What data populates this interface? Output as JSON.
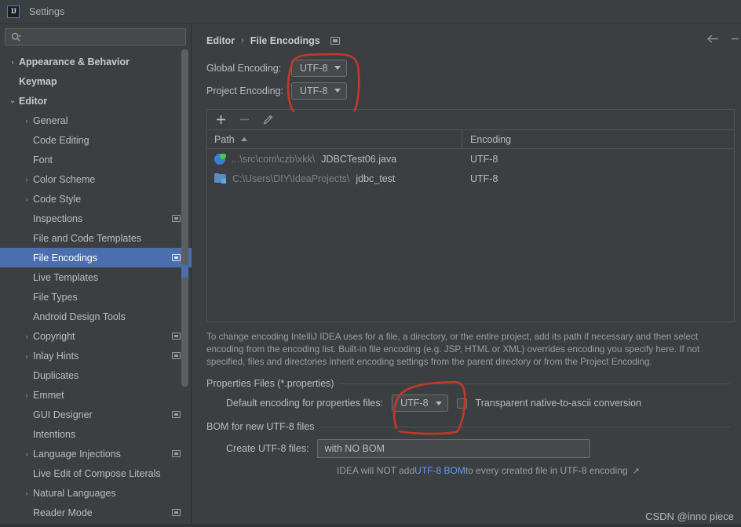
{
  "window": {
    "logo_text": "IJ",
    "title": "Settings"
  },
  "sidebar": {
    "search": {
      "value": "",
      "placeholder": ""
    },
    "items": [
      {
        "label": "Appearance & Behavior",
        "twisty": "›",
        "indent": 0,
        "bold": true,
        "badge": false,
        "selected": false
      },
      {
        "label": "Keymap",
        "twisty": "",
        "indent": 0,
        "bold": true,
        "badge": false,
        "selected": false
      },
      {
        "label": "Editor",
        "twisty": "⌄",
        "indent": 0,
        "bold": true,
        "badge": false,
        "selected": false
      },
      {
        "label": "General",
        "twisty": "›",
        "indent": 1,
        "bold": false,
        "badge": false,
        "selected": false
      },
      {
        "label": "Code Editing",
        "twisty": "",
        "indent": 1,
        "bold": false,
        "badge": false,
        "selected": false
      },
      {
        "label": "Font",
        "twisty": "",
        "indent": 1,
        "bold": false,
        "badge": false,
        "selected": false
      },
      {
        "label": "Color Scheme",
        "twisty": "›",
        "indent": 1,
        "bold": false,
        "badge": false,
        "selected": false
      },
      {
        "label": "Code Style",
        "twisty": "›",
        "indent": 1,
        "bold": false,
        "badge": false,
        "selected": false
      },
      {
        "label": "Inspections",
        "twisty": "",
        "indent": 1,
        "bold": false,
        "badge": true,
        "selected": false
      },
      {
        "label": "File and Code Templates",
        "twisty": "",
        "indent": 1,
        "bold": false,
        "badge": false,
        "selected": false
      },
      {
        "label": "File Encodings",
        "twisty": "",
        "indent": 1,
        "bold": false,
        "badge": true,
        "selected": true
      },
      {
        "label": "Live Templates",
        "twisty": "",
        "indent": 1,
        "bold": false,
        "badge": false,
        "selected": false
      },
      {
        "label": "File Types",
        "twisty": "",
        "indent": 1,
        "bold": false,
        "badge": false,
        "selected": false
      },
      {
        "label": "Android Design Tools",
        "twisty": "",
        "indent": 1,
        "bold": false,
        "badge": false,
        "selected": false
      },
      {
        "label": "Copyright",
        "twisty": "›",
        "indent": 1,
        "bold": false,
        "badge": true,
        "selected": false
      },
      {
        "label": "Inlay Hints",
        "twisty": "›",
        "indent": 1,
        "bold": false,
        "badge": true,
        "selected": false
      },
      {
        "label": "Duplicates",
        "twisty": "",
        "indent": 1,
        "bold": false,
        "badge": false,
        "selected": false
      },
      {
        "label": "Emmet",
        "twisty": "›",
        "indent": 1,
        "bold": false,
        "badge": false,
        "selected": false
      },
      {
        "label": "GUI Designer",
        "twisty": "",
        "indent": 1,
        "bold": false,
        "badge": true,
        "selected": false
      },
      {
        "label": "Intentions",
        "twisty": "",
        "indent": 1,
        "bold": false,
        "badge": false,
        "selected": false
      },
      {
        "label": "Language Injections",
        "twisty": "›",
        "indent": 1,
        "bold": false,
        "badge": true,
        "selected": false
      },
      {
        "label": "Live Edit of Compose Literals",
        "twisty": "",
        "indent": 1,
        "bold": false,
        "badge": false,
        "selected": false
      },
      {
        "label": "Natural Languages",
        "twisty": "›",
        "indent": 1,
        "bold": false,
        "badge": false,
        "selected": false
      },
      {
        "label": "Reader Mode",
        "twisty": "",
        "indent": 1,
        "bold": false,
        "badge": true,
        "selected": false
      }
    ]
  },
  "content": {
    "breadcrumb": {
      "parent": "Editor",
      "separator": "›",
      "current": "File Encodings"
    },
    "global_encoding": {
      "label": "Global Encoding:",
      "value": "UTF-8"
    },
    "project_encoding": {
      "label": "Project Encoding:",
      "value": "UTF-8"
    },
    "table": {
      "toolbar": {
        "add": "+",
        "remove": "−",
        "edit": "pencil-icon"
      },
      "columns": [
        "Path",
        "Encoding"
      ],
      "sort_column": "Path",
      "sort_direction": "ascending",
      "rows": [
        {
          "icon": "java-class-icon",
          "path_dim": "...\\src\\com\\czb\\xkk\\",
          "path_bold": "JDBCTest06.java",
          "encoding": "UTF-8"
        },
        {
          "icon": "module-folder-icon",
          "path_dim": "C:\\Users\\DIY\\IdeaProjects\\",
          "path_bold": "jdbc_test",
          "encoding": "UTF-8"
        }
      ]
    },
    "description": "To change encoding IntelliJ IDEA uses for a file, a directory, or the entire project, add its path if necessary and then select encoding from the encoding list. Built-in file encoding (e.g. JSP, HTML or XML) overrides encoding you specify here. If not specified, files and directories inherit encoding settings from the parent directory or from the Project Encoding.",
    "properties_section": {
      "title": "Properties Files (*.properties)",
      "default_encoding_label": "Default encoding for properties files:",
      "default_encoding_value": "UTF-8",
      "transparent_checkbox_label": "Transparent native-to-ascii conversion",
      "transparent_checked": false
    },
    "bom_section": {
      "title": "BOM for new UTF-8 files",
      "create_label": "Create UTF-8 files:",
      "create_value": "with NO BOM",
      "hint_prefix": "IDEA will NOT add ",
      "hint_link": "UTF-8 BOM",
      "hint_suffix": " to every created file in UTF-8 encoding",
      "hint_external_glyph": "↗"
    }
  },
  "annotations": {
    "color": "#c0392b",
    "regions": [
      "encoding-dropdowns-circle",
      "properties-encoding-circle"
    ]
  },
  "watermark": {
    "text": "CSDN @inno piece"
  },
  "colors": {
    "background": "#3c3f41",
    "selection": "#4b6eaf",
    "text": "#bbbbbb",
    "dim_text": "#9a9da0",
    "link": "#5e9ee6",
    "annotation": "#c0392b"
  }
}
